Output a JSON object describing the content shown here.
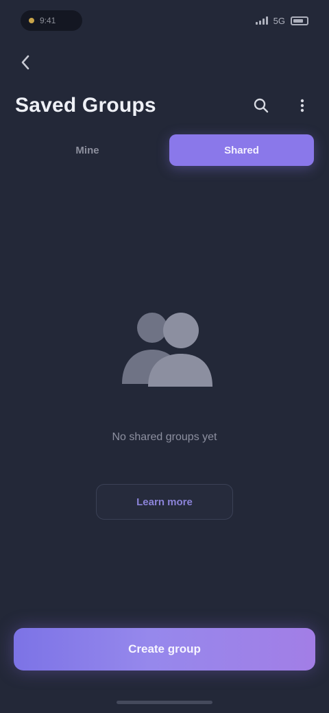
{
  "status_bar": {
    "time": "9:41",
    "pill_text": "",
    "network": "5G"
  },
  "header": {
    "back_icon": "chevron-left-icon",
    "title": "Saved Groups",
    "actions": [
      "search-icon",
      "more-icon"
    ]
  },
  "tabs": [
    {
      "label": "Mine",
      "active": false
    },
    {
      "label": "Shared",
      "active": true
    }
  ],
  "empty_state": {
    "illustration": "users-icon",
    "title": "No shared groups yet",
    "subtitle": "",
    "button_label": "Learn more"
  },
  "cta": {
    "label": "Create group"
  },
  "colors": {
    "background": "#232838",
    "accent": "#8a78ea",
    "gradient_start": "#7c73e6",
    "gradient_end": "#a27ee6"
  }
}
